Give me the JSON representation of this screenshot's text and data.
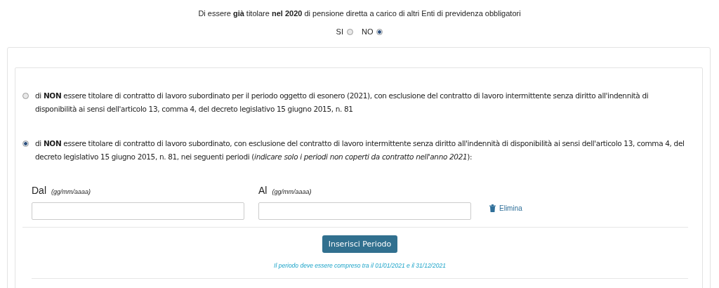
{
  "question": {
    "text": "Di essere **già** titolare **nel 2020** di pensione diretta a carico di altri Enti di previdenza obbligatori",
    "options": [
      {
        "label": "SI",
        "selected": false
      },
      {
        "label": "NO",
        "selected": true
      }
    ]
  },
  "choices": [
    {
      "text": "di **NON** essere titolare di contratto di lavoro subordinato per il periodo oggetto di esonero (2021), con esclusione del contratto di lavoro intermittente senza diritto all'indennità di disponibilità ai sensi dell'articolo 13, comma 4, del decreto legislativo 15 giugno 2015, n. 81",
      "selected": false
    },
    {
      "text": "di **NON** essere titolare di contratto di lavoro subordinato, con esclusione del contratto di lavoro intermittente senza diritto all'indennità di disponibilità ai sensi dell'articolo 13, comma 4, del decreto legislativo 15 giugno 2015, n. 81, nei seguenti periodi (*indicare solo i periodi non coperti da contratto nell'anno 2021*):",
      "selected": true
    }
  ],
  "period": {
    "from": {
      "label": "Dal",
      "hint": "(gg/mm/aaaa)"
    },
    "to": {
      "label": "Al",
      "hint": "(gg/mm/aaaa)"
    },
    "delete": "Elimina",
    "add_button": "Inserisci Periodo",
    "note": "Il periodo deve essere compreso tra il 01/01/2021 e il 31/12/2021"
  }
}
